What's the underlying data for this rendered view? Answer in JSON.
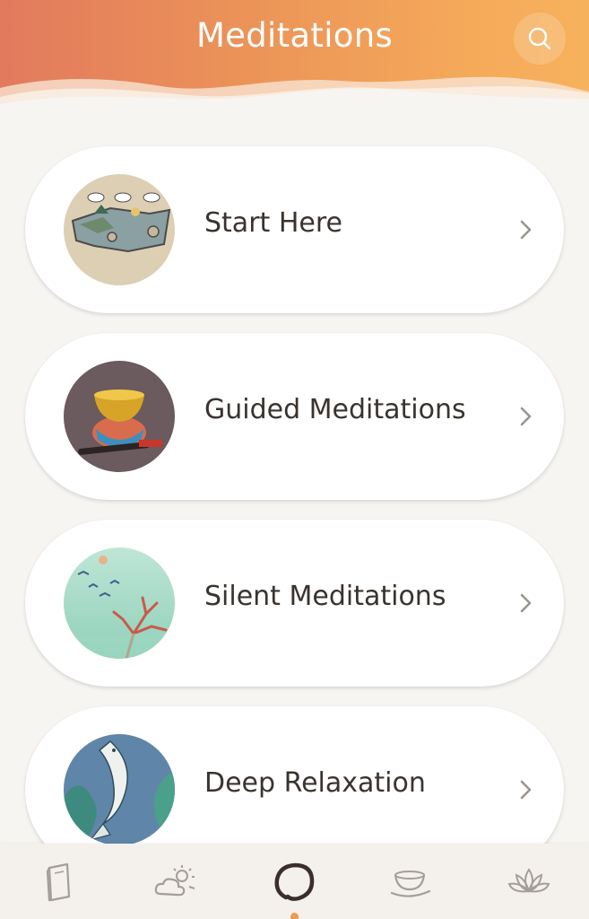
{
  "header": {
    "title": "Meditations",
    "search_icon": "search-icon"
  },
  "colors": {
    "header_gradient_start": "#e27a5d",
    "header_gradient_end": "#f7b25d",
    "background": "#f7f5f2",
    "card": "#ffffff",
    "text": "#3a332e",
    "nav_active": "#3a2f2a",
    "nav_inactive": "#a39e99",
    "nav_indicator": "#ef9a53"
  },
  "categories": [
    {
      "label": "Start Here",
      "icon": "landscape-map-thumbnail"
    },
    {
      "label": "Guided Meditations",
      "icon": "singing-bowl-thumbnail"
    },
    {
      "label": "Silent Meditations",
      "icon": "birds-coral-thumbnail"
    },
    {
      "label": "Deep Relaxation",
      "icon": "koi-fish-thumbnail"
    }
  ],
  "bottom_nav": {
    "items": [
      {
        "name": "book",
        "icon": "book-icon",
        "active": false
      },
      {
        "name": "weather",
        "icon": "cloud-sun-icon",
        "active": false
      },
      {
        "name": "meditations",
        "icon": "enso-circle-icon",
        "active": true
      },
      {
        "name": "tea",
        "icon": "tea-bowl-icon",
        "active": false
      },
      {
        "name": "lotus",
        "icon": "lotus-icon",
        "active": false
      }
    ]
  }
}
